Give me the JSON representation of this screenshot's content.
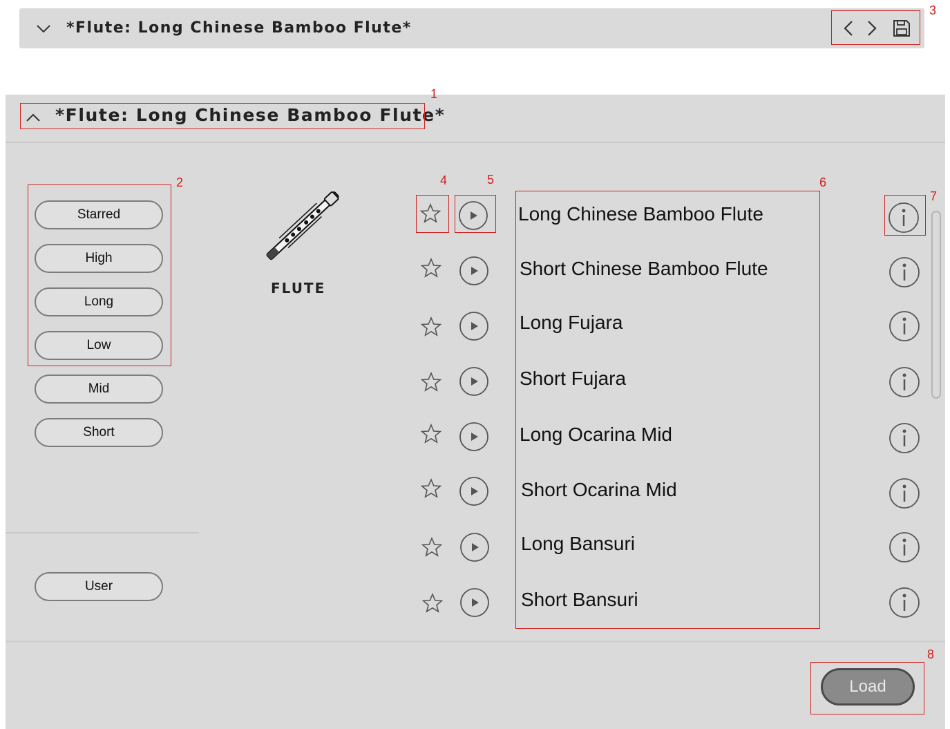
{
  "header": {
    "title": "*Flute: Long Chinese Bamboo Flute*",
    "icons": [
      "chevron-down-icon",
      "prev-icon",
      "next-icon",
      "save-icon"
    ]
  },
  "panel": {
    "title": "*Flute: Long Chinese Bamboo Flute*",
    "collapse_icon": "chevron-up-icon"
  },
  "filters": [
    {
      "label": "Starred"
    },
    {
      "label": "High"
    },
    {
      "label": "Long"
    },
    {
      "label": "Low"
    },
    {
      "label": "Mid"
    },
    {
      "label": "Short"
    }
  ],
  "user_filter": {
    "label": "User"
  },
  "instrument": {
    "label": "FLUTE"
  },
  "presets": [
    {
      "name": "Long Chinese Bamboo Flute"
    },
    {
      "name": "Short Chinese Bamboo Flute"
    },
    {
      "name": "Long Fujara"
    },
    {
      "name": "Short Fujara"
    },
    {
      "name": "Long Ocarina Mid"
    },
    {
      "name": "Short Ocarina Mid"
    },
    {
      "name": "Long Bansuri"
    },
    {
      "name": "Short Bansuri"
    }
  ],
  "footer": {
    "load_label": "Load"
  },
  "annotations": [
    "1",
    "2",
    "3",
    "4",
    "5",
    "6",
    "7",
    "8"
  ],
  "colors": {
    "panel_bg": "#dadada",
    "annotation": "#d02020",
    "load_bg": "#8a8a8a"
  }
}
